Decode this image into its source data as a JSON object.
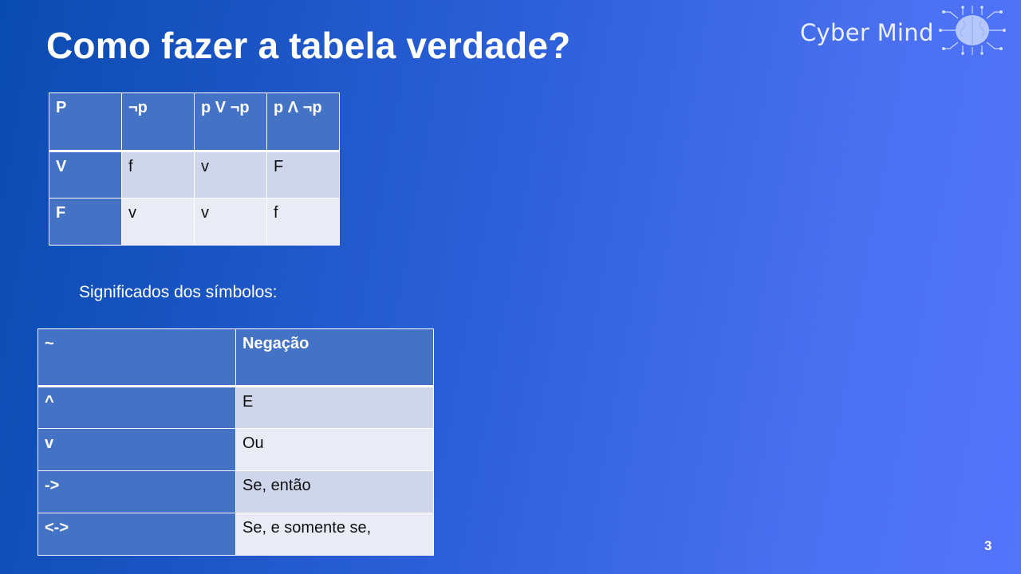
{
  "slide": {
    "title": "Como fazer a tabela verdade?",
    "page_number": "3"
  },
  "logo": {
    "text": "Cyber Mind",
    "icon": "brain-circuit-icon"
  },
  "truth_table": {
    "headers": [
      "P",
      "¬p",
      "p V ¬p",
      "p Λ ¬p"
    ],
    "rows": [
      [
        "V",
        "f",
        "v",
        "F"
      ],
      [
        "F",
        "v",
        "v",
        "f"
      ]
    ]
  },
  "symbols_caption": "Significados dos símbolos:",
  "symbols_table": {
    "headers": [
      "~",
      "Negação"
    ],
    "rows": [
      [
        "^",
        "E"
      ],
      [
        "v",
        "Ou"
      ],
      [
        "->",
        "Se, então"
      ],
      [
        "<->",
        "Se, e somente se,"
      ]
    ]
  },
  "colors": {
    "header_blue": "#4472c4",
    "row_band_dark": "#cfd5ea",
    "row_band_light": "#e9ebf5",
    "background_start": "#0a4bb0",
    "background_end": "#5474fb"
  }
}
